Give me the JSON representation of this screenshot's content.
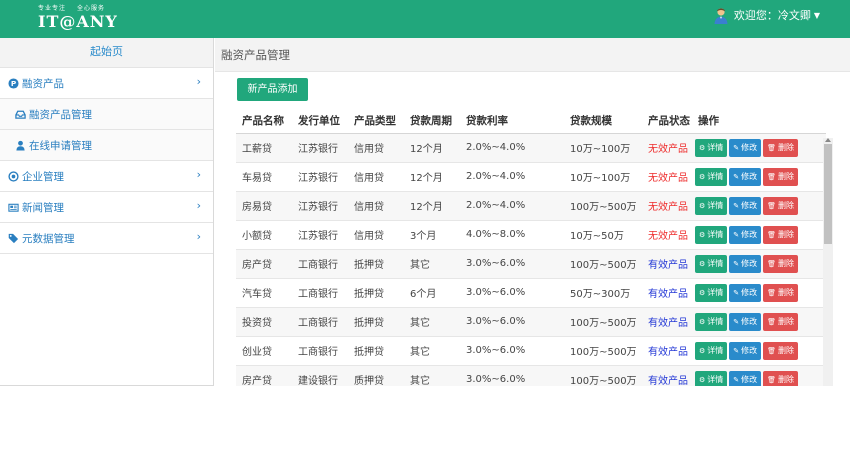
{
  "header": {
    "slogan_left": "专业专注",
    "slogan_right": "全心服务",
    "brand": "IT@ANY",
    "user_greeting": "欢迎您：冷文卿",
    "brand_color": "#21a77c"
  },
  "sidebar": {
    "home_label": "起始页",
    "items": [
      {
        "label": "融资产品",
        "icon": "coin-icon",
        "expandable": true
      },
      {
        "label": "融资产品管理",
        "icon": "inbox-icon",
        "sub": true
      },
      {
        "label": "在线申请管理",
        "icon": "user-icon",
        "sub": true
      },
      {
        "label": "企业管理",
        "icon": "circle-icon",
        "expandable": true
      },
      {
        "label": "新闻管理",
        "icon": "newspaper-icon",
        "expandable": true
      },
      {
        "label": "元数据管理",
        "icon": "tags-icon",
        "expandable": true
      }
    ]
  },
  "main": {
    "title": "融资产品管理",
    "add_button": "新产品添加",
    "columns": [
      "产品名称",
      "发行单位",
      "产品类型",
      "贷款周期",
      "贷款利率",
      "贷款规模",
      "产品状态",
      "操作"
    ],
    "actions": {
      "detail": "详情",
      "edit": "修改",
      "delete": "删除"
    },
    "rows": [
      {
        "name": "工薪贷",
        "issuer": "江苏银行",
        "type": "信用贷",
        "term": "12个月",
        "rate": "2.0%~4.0%",
        "scale": "10万~100万",
        "status": "无效产品",
        "valid": false
      },
      {
        "name": "车易贷",
        "issuer": "江苏银行",
        "type": "信用贷",
        "term": "12个月",
        "rate": "2.0%~4.0%",
        "scale": "10万~100万",
        "status": "无效产品",
        "valid": false
      },
      {
        "name": "房易贷",
        "issuer": "江苏银行",
        "type": "信用贷",
        "term": "12个月",
        "rate": "2.0%~4.0%",
        "scale": "100万~500万",
        "status": "无效产品",
        "valid": false
      },
      {
        "name": "小额贷",
        "issuer": "江苏银行",
        "type": "信用贷",
        "term": "3个月",
        "rate": "4.0%~8.0%",
        "scale": "10万~50万",
        "status": "无效产品",
        "valid": false
      },
      {
        "name": "房产贷",
        "issuer": "工商银行",
        "type": "抵押贷",
        "term": "其它",
        "rate": "3.0%~6.0%",
        "scale": "100万~500万",
        "status": "有效产品",
        "valid": true
      },
      {
        "name": "汽车贷",
        "issuer": "工商银行",
        "type": "抵押贷",
        "term": "6个月",
        "rate": "3.0%~6.0%",
        "scale": "50万~300万",
        "status": "有效产品",
        "valid": true
      },
      {
        "name": "投资贷",
        "issuer": "工商银行",
        "type": "抵押贷",
        "term": "其它",
        "rate": "3.0%~6.0%",
        "scale": "100万~500万",
        "status": "有效产品",
        "valid": true
      },
      {
        "name": "创业贷",
        "issuer": "工商银行",
        "type": "抵押贷",
        "term": "其它",
        "rate": "3.0%~6.0%",
        "scale": "100万~500万",
        "status": "有效产品",
        "valid": true
      },
      {
        "name": "房产贷",
        "issuer": "建设银行",
        "type": "质押贷",
        "term": "其它",
        "rate": "3.0%~6.0%",
        "scale": "100万~500万",
        "status": "有效产品",
        "valid": true
      }
    ]
  }
}
